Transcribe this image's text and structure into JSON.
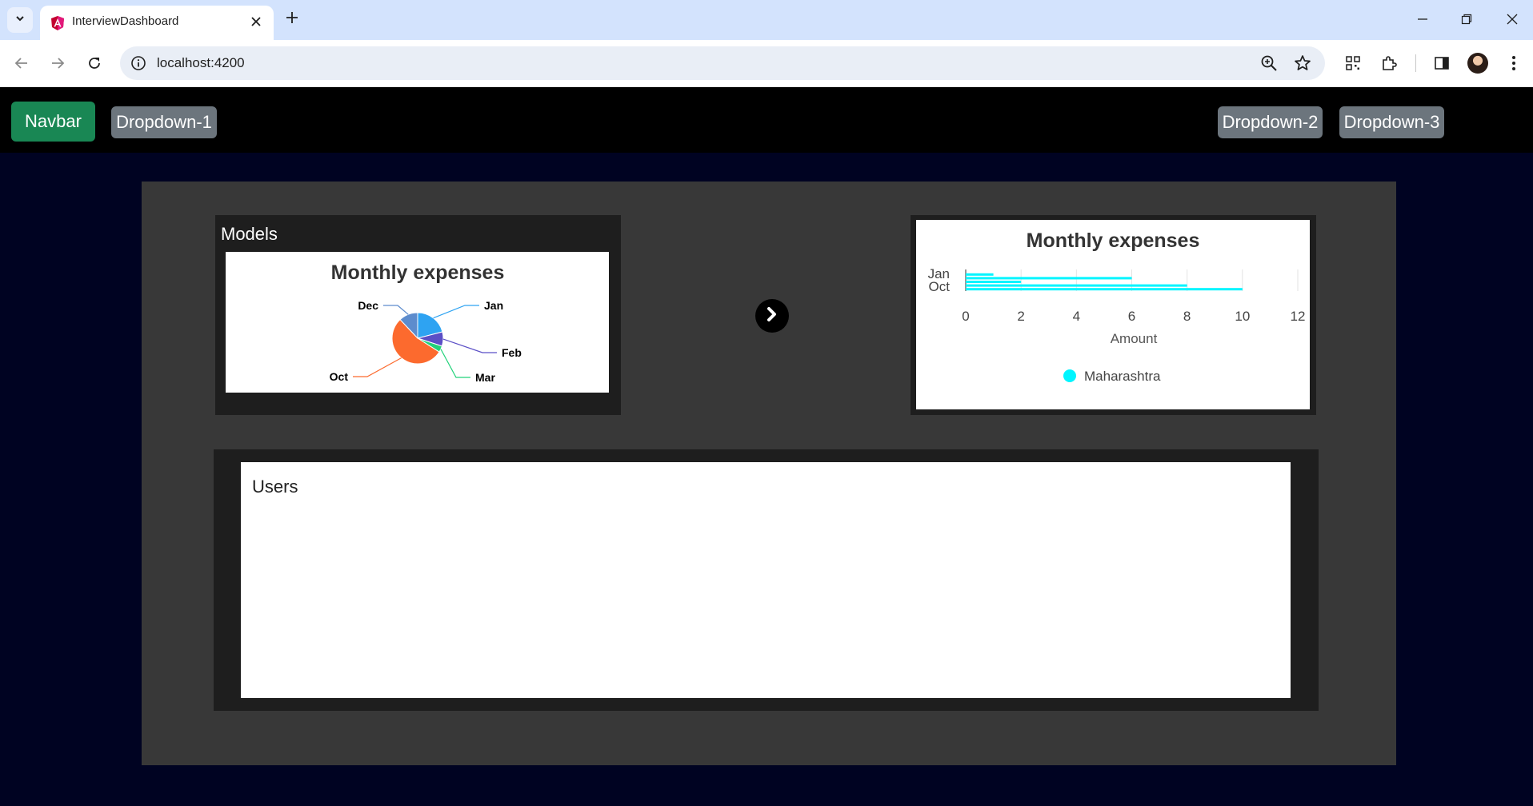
{
  "browser": {
    "tab_title": "InterviewDashboard",
    "url": "localhost:4200"
  },
  "navbar": {
    "brand": "Navbar",
    "dropdown1": "Dropdown-1",
    "dropdown2": "Dropdown-2",
    "dropdown3": "Dropdown-3"
  },
  "models": {
    "label": "Models"
  },
  "users": {
    "label": "Users"
  },
  "colors": {
    "brand": "#198754",
    "dropdown": "#6c757d",
    "page_bg": "#000322",
    "container_bg": "#383838",
    "card_bg": "#1e1e1e",
    "bar_series": "#00f5ff"
  },
  "icons": {
    "tab_search": "chevron-down-icon",
    "favicon": "angular-icon",
    "next": "chevron-right-circle-icon"
  },
  "chart_data": [
    {
      "type": "pie",
      "title": "Monthly expenses",
      "categories": [
        "Jan",
        "Feb",
        "Mar",
        "Oct",
        "Dec"
      ],
      "values": [
        21,
        9,
        4,
        54,
        12
      ],
      "colors": [
        "#2ea3f2",
        "#5b4fc6",
        "#21d27a",
        "#fc6a2e",
        "#5d8ccd"
      ]
    },
    {
      "type": "bar",
      "orientation": "horizontal",
      "title": "Monthly expenses",
      "xlabel": "Amount",
      "xlim": [
        0,
        12
      ],
      "xticks": [
        0,
        2,
        4,
        6,
        8,
        10,
        12
      ],
      "ytick_labels": [
        "Jan",
        "Oct"
      ],
      "legend": "bottom-center",
      "series": [
        {
          "name": "Maharashtra",
          "values": [
            1,
            6,
            2,
            8,
            10
          ]
        }
      ]
    }
  ]
}
